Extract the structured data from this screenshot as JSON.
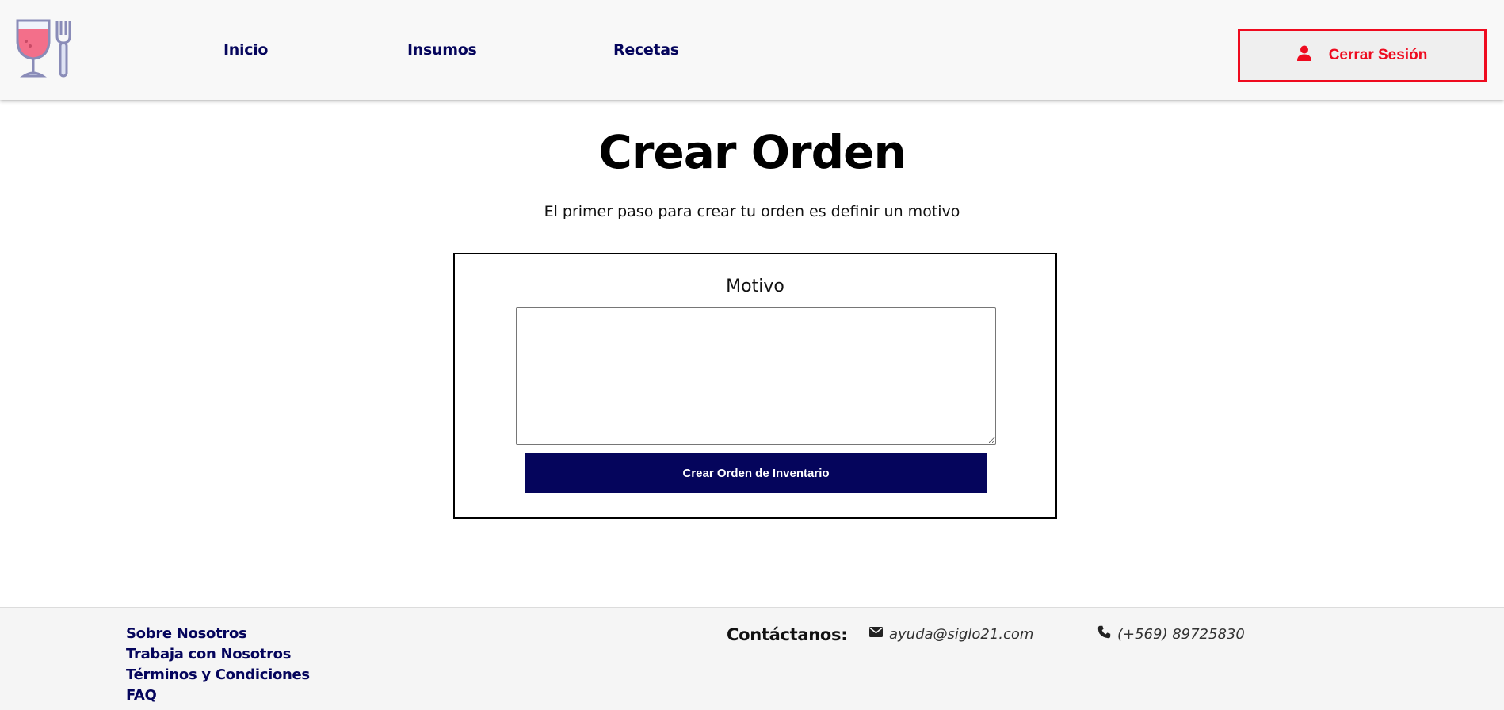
{
  "header": {
    "logo_icon": "wine-glass-and-fork-icon",
    "nav": [
      {
        "label": "Inicio"
      },
      {
        "label": "Insumos"
      },
      {
        "label": "Recetas"
      }
    ],
    "logout": {
      "label": "Cerrar Sesión",
      "icon": "user-icon"
    }
  },
  "main": {
    "title": "Crear Orden",
    "subtitle": "El primer paso para crear tu orden es definir un motivo",
    "form": {
      "label": "Motivo",
      "motivo_value": "",
      "submit_label": "Crear Orden de Inventario"
    }
  },
  "footer": {
    "links": [
      {
        "label": "Sobre Nosotros"
      },
      {
        "label": "Trabaja con Nosotros"
      },
      {
        "label": "Términos y Condiciones"
      },
      {
        "label": "FAQ"
      }
    ],
    "contact_label": "Contáctanos:",
    "email": "ayuda@siglo21.com",
    "phone": "(+569) 89725830"
  },
  "colors": {
    "primary": "#05055c",
    "logout_red": "#ee0b1f",
    "header_bg": "#f8f8f8",
    "footer_bg": "#f5f5f5"
  }
}
